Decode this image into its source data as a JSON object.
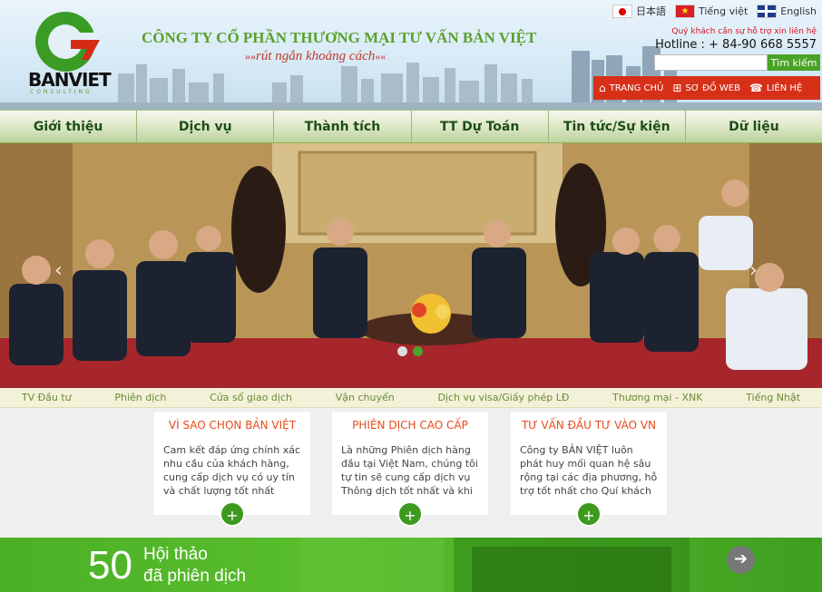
{
  "brand": {
    "logo_text": "BANVIET",
    "logo_sub": "CONSULTING",
    "company_name": "CÔNG TY CỔ PHẦN THƯƠNG MẠI TƯ VẤN BẢN VIỆT",
    "slogan": "rút ngắn khoảng cách"
  },
  "languages": [
    {
      "label": "日本語",
      "flag": "flag-japan-icon"
    },
    {
      "label": "Tiếng việt",
      "flag": "flag-vietnam-icon"
    },
    {
      "label": "English",
      "flag": "flag-uk-icon"
    }
  ],
  "support": {
    "note": "Quý khách cần sự hỗ trợ xin liên hệ",
    "hotline": "Hotline : + 84-90 668 5557"
  },
  "search": {
    "placeholder": "",
    "button_label": "Tìm kiếm"
  },
  "top_links": [
    {
      "label": "TRANG CHỦ",
      "icon": "home-icon"
    },
    {
      "label": "SƠ ĐỒ WEB",
      "icon": "sitemap-icon"
    },
    {
      "label": "LIÊN HỆ",
      "icon": "phone-icon"
    }
  ],
  "nav": [
    "Giới thiệu",
    "Dịch vụ",
    "Thành tích",
    "TT Dự Toán",
    "Tin tức/Sự kiện",
    "Dữ liệu"
  ],
  "slider": {
    "slides": 2,
    "active": 2
  },
  "subnav": [
    "TV Đầu tư",
    "Phiên dịch",
    "Cửa sổ giao dịch",
    "Vận chuyển",
    "Dịch vụ visa/Giấy phép LĐ",
    "Thương mại - XNK",
    "Tiếng Nhật"
  ],
  "cards": [
    {
      "title": "VÌ SAO CHỌN BẢN VIỆT",
      "text": "Cam kết đáp ứng chính xác nhu cầu của khách hàng, cung cấp dịch vụ có uy tín và chất lượng tốt nhất"
    },
    {
      "title": "PHIÊN DỊCH CAO CẤP",
      "text": "Là những Phiên dịch hàng đầu tại Việt Nam, chúng tôi tự tin sẽ cung cấp dịch vụ Thông dịch tốt nhất và khi"
    },
    {
      "title": "TƯ VẤN ĐẦU TƯ VÀO VN",
      "text": "Công ty BẢN VIỆT luôn phát huy mối quan hệ sâu rộng tại các địa phương, hỗ trợ tốt nhất cho Quí khách"
    }
  ],
  "banner": {
    "number": "50",
    "line1": "Hội thảo",
    "line2": "đã phiên dịch"
  },
  "colors": {
    "brand_green": "#4aa326",
    "accent_red": "#d63018",
    "card_title": "#e84a1b"
  }
}
